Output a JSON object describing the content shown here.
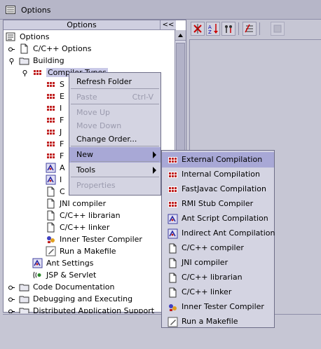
{
  "window": {
    "title": "Options"
  },
  "explorer": {
    "column_header": "Options",
    "collapse_label": "<<",
    "rows": [
      {
        "label": "Options",
        "icon": "options-icon",
        "expander": "",
        "indent": 0
      },
      {
        "label": "C/C++ Options",
        "icon": "document-icon",
        "expander": "collapsed",
        "indent": 1
      },
      {
        "label": "Building",
        "icon": "folder-icon",
        "expander": "expanded",
        "indent": 1
      },
      {
        "label": "Compiler Types",
        "icon": "compiler-icon",
        "expander": "expanded",
        "indent": 2,
        "selected": true
      },
      {
        "label": "S",
        "icon": "compiler-icon",
        "expander": "",
        "indent": 3
      },
      {
        "label": "E",
        "icon": "compiler-icon",
        "expander": "",
        "indent": 3
      },
      {
        "label": "I",
        "icon": "compiler-icon",
        "expander": "",
        "indent": 3
      },
      {
        "label": "F",
        "icon": "compiler-icon",
        "expander": "",
        "indent": 3
      },
      {
        "label": "J",
        "icon": "compiler-icon",
        "expander": "",
        "indent": 3
      },
      {
        "label": "F",
        "icon": "compiler-icon",
        "expander": "",
        "indent": 3
      },
      {
        "label": "F",
        "icon": "compiler-icon",
        "expander": "",
        "indent": 3
      },
      {
        "label": "A",
        "icon": "ant-icon",
        "expander": "",
        "indent": 3
      },
      {
        "label": "I",
        "icon": "ant-icon",
        "expander": "",
        "indent": 3
      },
      {
        "label": "C",
        "icon": "document-icon",
        "expander": "",
        "indent": 3
      },
      {
        "label": "JNI compiler",
        "icon": "document-icon",
        "expander": "",
        "indent": 3
      },
      {
        "label": "C/C++ librarian",
        "icon": "document-icon",
        "expander": "",
        "indent": 3
      },
      {
        "label": "C/C++ linker",
        "icon": "document-icon",
        "expander": "",
        "indent": 3
      },
      {
        "label": "Inner Tester Compiler",
        "icon": "tester-icon",
        "expander": "",
        "indent": 3
      },
      {
        "label": "Run a Makefile",
        "icon": "makefile-icon",
        "expander": "",
        "indent": 3
      },
      {
        "label": "Ant Settings",
        "icon": "ant-icon",
        "expander": "",
        "indent": 2
      },
      {
        "label": "JSP & Servlet",
        "icon": "jsp-icon",
        "expander": "",
        "indent": 2
      },
      {
        "label": "Code Documentation",
        "icon": "folder-icon",
        "expander": "collapsed",
        "indent": 1
      },
      {
        "label": "Debugging and Executing",
        "icon": "folder-icon",
        "expander": "collapsed",
        "indent": 1
      },
      {
        "label": "Distributed Application Support",
        "icon": "folder-icon",
        "expander": "collapsed",
        "indent": 1
      }
    ]
  },
  "context_menu": {
    "items": [
      {
        "label": "Refresh Folder",
        "accel": "",
        "enabled": true,
        "submenu": false
      },
      {
        "separator": true
      },
      {
        "label": "Paste",
        "accel": "Ctrl-V",
        "enabled": false,
        "submenu": false
      },
      {
        "separator": true
      },
      {
        "label": "Move Up",
        "accel": "",
        "enabled": false,
        "submenu": false
      },
      {
        "label": "Move Down",
        "accel": "",
        "enabled": false,
        "submenu": false
      },
      {
        "label": "Change Order...",
        "accel": "",
        "enabled": true,
        "submenu": false
      },
      {
        "separator": true
      },
      {
        "label": "New",
        "accel": "",
        "enabled": true,
        "submenu": true,
        "highlighted": true
      },
      {
        "separator": true
      },
      {
        "label": "Tools",
        "accel": "",
        "enabled": true,
        "submenu": true
      },
      {
        "separator": true
      },
      {
        "label": "Properties",
        "accel": "",
        "enabled": false,
        "submenu": false
      }
    ]
  },
  "new_submenu": {
    "items": [
      {
        "label": "External Compilation",
        "icon": "compiler-icon",
        "highlighted": true
      },
      {
        "label": "Internal Compilation",
        "icon": "compiler-icon"
      },
      {
        "label": "FastJavac Compilation",
        "icon": "compiler-icon"
      },
      {
        "label": "RMI Stub Compiler",
        "icon": "compiler-icon"
      },
      {
        "label": "Ant Script Compilation",
        "icon": "ant-icon"
      },
      {
        "label": "Indirect Ant Compilation",
        "icon": "ant-icon"
      },
      {
        "label": "C/C++ compiler",
        "icon": "document-icon"
      },
      {
        "label": "JNI compiler",
        "icon": "document-icon"
      },
      {
        "label": "C/C++ librarian",
        "icon": "document-icon"
      },
      {
        "label": "C/C++ linker",
        "icon": "document-icon"
      },
      {
        "label": "Inner Tester Compiler",
        "icon": "tester-icon"
      },
      {
        "label": "Run a Makefile",
        "icon": "makefile-icon"
      }
    ]
  },
  "toolbar": {
    "buttons": [
      {
        "name": "sort-by-name-icon"
      },
      {
        "name": "sort-by-category-icon"
      },
      {
        "name": "show-properties-icon"
      },
      {
        "name": "customize-icon"
      },
      {
        "name": "disabled-tool-icon"
      }
    ]
  },
  "colors": {
    "selection": "#c9c9e7",
    "highlight": "#a8a8d6",
    "background": "#c6c6d4"
  }
}
